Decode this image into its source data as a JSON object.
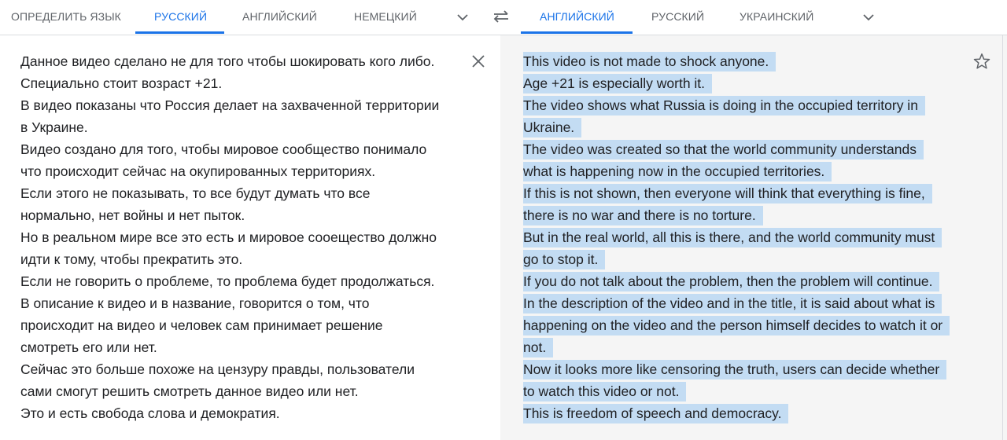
{
  "source_tabs": [
    "ОПРЕДЕЛИТЬ ЯЗЫК",
    "РУССКИЙ",
    "АНГЛИЙСКИЙ",
    "НЕМЕЦКИЙ"
  ],
  "target_tabs": [
    "АНГЛИЙСКИЙ",
    "РУССКИЙ",
    "УКРАИНСКИЙ"
  ],
  "icons": {
    "source_more": "chevron-down-icon",
    "swap": "swap-languages-icon",
    "target_more": "chevron-down-icon",
    "clear": "close-icon",
    "save": "star-icon"
  },
  "colors": {
    "accent": "#1a73e8",
    "selection": "#c3dcf3",
    "result_background": "#f5f5f5"
  },
  "source_text": [
    "Данное видео сделано не для того чтобы шокировать кого либо.",
    "Специально стоит возраст +21.",
    "В видео показаны что Россия делает на захваченной территории",
    "в Украине.",
    "Видео создано для того, чтобы мировое сообщество понимало",
    "что происходит сейчас на окупированных территориях.",
    "Если этого не показывать, то все будут думать что все",
    "нормально, нет войны и нет пыток.",
    "Но в реальном мире все это есть и мировое сооещество должно",
    "идти к тому, чтобы прекратить это.",
    "Если не говорить о проблеме, то проблема будет продолжаться.",
    "В описание к видео и в название, говорится о том, что",
    "происходит на видео и человек сам принимает решение",
    "смотреть его или нет.",
    "Сейчас это больше похоже на цензуру правды, пользователи",
    "сами смогут решить смотреть данное видео или нет.",
    "Это и есть свобода слова и демократия."
  ],
  "translation_text": [
    "This video is not made to shock anyone.",
    "Age +21 is especially worth it.",
    "The video shows what Russia is doing in the occupied territory in",
    "Ukraine.",
    "The video was created so that the world community understands",
    "what is happening now in the occupied territories.",
    "If this is not shown, then everyone will think that everything is fine,",
    "there is no war and there is no torture.",
    "But in the real world, all this is there, and the world community must",
    "go to stop it.",
    "If you do not talk about the problem, then the problem will continue.",
    "In the description of the video and in the title, it is said about what is",
    "happening on the video and the person himself decides to watch it or",
    "not.",
    "Now it looks more like censoring the truth, users can decide whether",
    "to watch this video or not.",
    "This is freedom of speech and democracy."
  ]
}
